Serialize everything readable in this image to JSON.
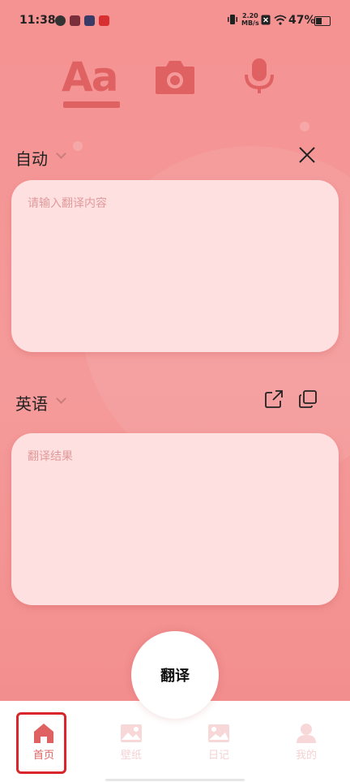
{
  "status_bar": {
    "time": "11:38",
    "net_speed_value": "2.20",
    "net_speed_unit": "MB/s",
    "battery": "47%"
  },
  "modes": {
    "text_mode_label": "Aa",
    "camera_icon": "camera-icon",
    "mic_icon": "microphone-icon",
    "active": "text"
  },
  "source": {
    "language": "自动",
    "placeholder": "请输入翻译内容"
  },
  "target": {
    "language": "英语",
    "placeholder": "翻译结果"
  },
  "translate_button": "翻译",
  "nav": {
    "items": [
      {
        "label": "首页",
        "icon": "home-icon",
        "active": true
      },
      {
        "label": "壁纸",
        "icon": "wallpaper-icon",
        "active": false
      },
      {
        "label": "日记",
        "icon": "diary-icon",
        "active": false
      },
      {
        "label": "我的",
        "icon": "profile-icon",
        "active": false
      }
    ]
  },
  "colors": {
    "accent": "#e06161",
    "background": "#f59a9a",
    "box": "#ffe0e1"
  }
}
